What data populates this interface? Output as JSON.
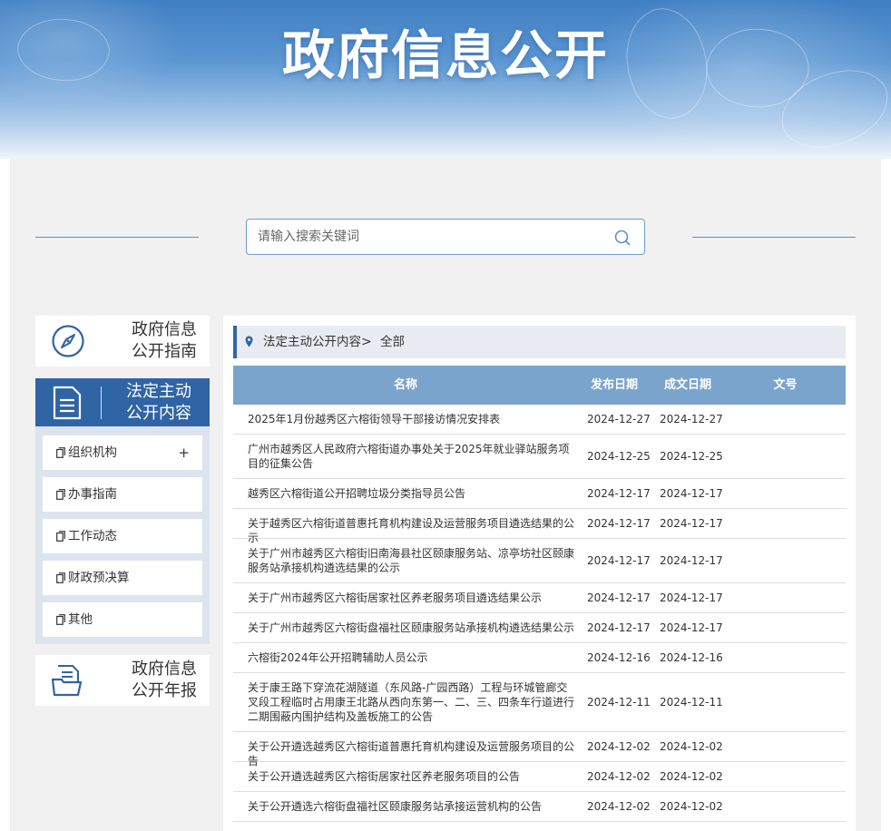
{
  "banner": {
    "title": "政府信息公开"
  },
  "search": {
    "placeholder": "请输入搜索关键词"
  },
  "sidebar": {
    "guide": {
      "line1": "政府信息",
      "line2": "公开指南"
    },
    "active": {
      "line1": "法定主动",
      "line2": "公开内容"
    },
    "items": [
      {
        "label": "组织机构",
        "expand": "+"
      },
      {
        "label": "办事指南"
      },
      {
        "label": "工作动态"
      },
      {
        "label": "财政预决算"
      },
      {
        "label": "其他"
      }
    ],
    "annual": {
      "line1": "政府信息",
      "line2": "公开年报"
    }
  },
  "breadcrumb": {
    "section": "法定主动公开内容",
    "separator": ">",
    "current": "全部"
  },
  "table": {
    "headers": {
      "name": "名称",
      "published": "发布日期",
      "created": "成文日期",
      "doc_no": "文号"
    },
    "rows": [
      {
        "name": "2025年1月份越秀区六榕街领导干部接访情况安排表",
        "published": "2024-12-27",
        "created": "2024-12-27",
        "doc_no": ""
      },
      {
        "name": "广州市越秀区人民政府六榕街道办事处关于2025年就业驿站服务项目的征集公告",
        "published": "2024-12-25",
        "created": "2024-12-25",
        "doc_no": ""
      },
      {
        "name": "越秀区六榕街道公开招聘垃圾分类指导员公告",
        "published": "2024-12-17",
        "created": "2024-12-17",
        "doc_no": ""
      },
      {
        "name": "关于越秀区六榕街道普惠托育机构建设及运营服务项目遴选结果的公示",
        "published": "2024-12-17",
        "created": "2024-12-17",
        "doc_no": ""
      },
      {
        "name": "关于广州市越秀区六榕街旧南海县社区颐康服务站、凉亭坊社区颐康服务站承接机构遴选结果的公示",
        "published": "2024-12-17",
        "created": "2024-12-17",
        "doc_no": ""
      },
      {
        "name": "关于广州市越秀区六榕街居家社区养老服务项目遴选结果公示",
        "published": "2024-12-17",
        "created": "2024-12-17",
        "doc_no": ""
      },
      {
        "name": "关于广州市越秀区六榕街盘福社区颐康服务站承接机构遴选结果公示",
        "published": "2024-12-17",
        "created": "2024-12-17",
        "doc_no": ""
      },
      {
        "name": "六榕街2024年公开招聘辅助人员公示",
        "published": "2024-12-16",
        "created": "2024-12-16",
        "doc_no": ""
      },
      {
        "name": "关于康王路下穿流花湖隧道（东风路-广园西路）工程与环城管廊交叉段工程临时占用康王北路从西向东第一、二、三、四条车行道进行二期围蔽内围护结构及盖板施工的公告",
        "published": "2024-12-11",
        "created": "2024-12-11",
        "doc_no": ""
      },
      {
        "name": "关于公开遴选越秀区六榕街道普惠托育机构建设及运营服务项目的公告",
        "published": "2024-12-02",
        "created": "2024-12-02",
        "doc_no": ""
      },
      {
        "name": "关于公开遴选越秀区六榕街居家社区养老服务项目的公告",
        "published": "2024-12-02",
        "created": "2024-12-02",
        "doc_no": ""
      },
      {
        "name": "关于公开遴选六榕街盘福社区颐康服务站承接运营机构的公告",
        "published": "2024-12-02",
        "created": "2024-12-02",
        "doc_no": ""
      }
    ]
  },
  "colors": {
    "brand": "#2f64a5",
    "table_header": "#7ba4cd",
    "panel_bg": "#f1f1f1"
  }
}
